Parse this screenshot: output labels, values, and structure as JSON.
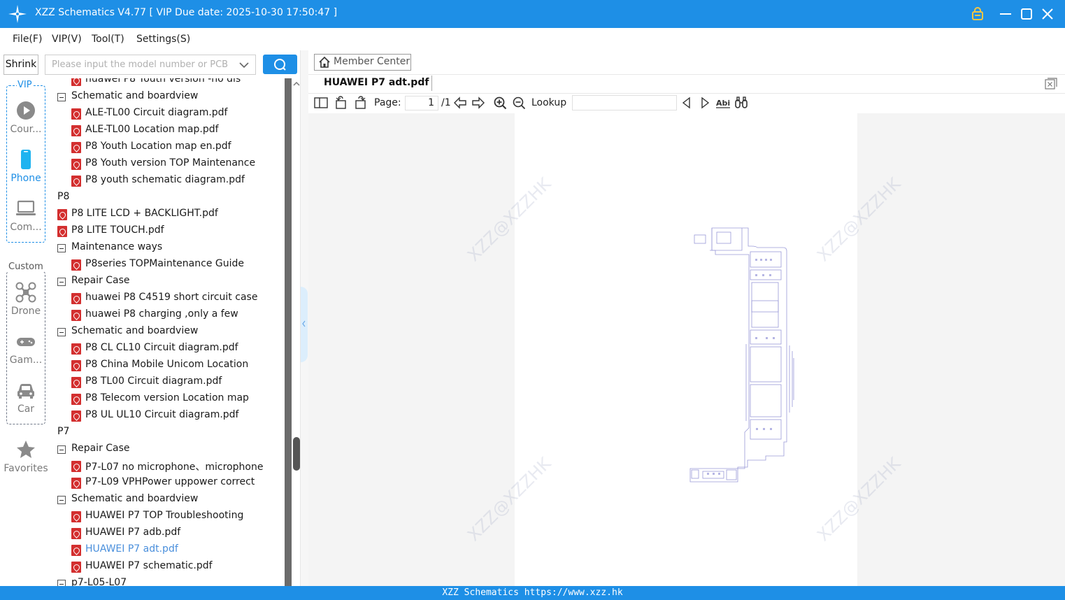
{
  "window": {
    "title": "XZZ Schematics V4.77 [ VIP Due date: 2025-10-30 17:50:47 ]"
  },
  "menu": [
    "File(F)",
    "VIP(V)",
    "Tool(T)",
    "Settings(S)"
  ],
  "search": {
    "shrink_label": "Shrink",
    "placeholder": "Please input the model number or PCB"
  },
  "sidebar": {
    "vip_label": "VIP",
    "custom_label": "Custom",
    "items": [
      {
        "label": "Cour...",
        "icon": "play-circle-icon"
      },
      {
        "label": "Phone",
        "icon": "phone-icon"
      },
      {
        "label": "Com...",
        "icon": "laptop-icon"
      },
      {
        "label": "Drone",
        "icon": "drone-icon"
      },
      {
        "label": "Gam...",
        "icon": "gamepad-icon"
      },
      {
        "label": "Car",
        "icon": "car-icon"
      },
      {
        "label": "Favorites",
        "icon": "star-icon"
      }
    ]
  },
  "tree": [
    {
      "label": "huawei P8 Youth version -no dis",
      "type": "file"
    },
    {
      "label": "Schematic and boardview",
      "type": "folder"
    },
    {
      "label": "ALE-TL00 Circuit diagram.pdf",
      "type": "file"
    },
    {
      "label": "ALE-TL00 Location map.pdf",
      "type": "file"
    },
    {
      "label": "P8 Youth Location map en.pdf",
      "type": "file"
    },
    {
      "label": "P8 Youth version TOP Maintenance",
      "type": "file"
    },
    {
      "label": "P8 youth schematic diagram.pdf",
      "type": "file"
    },
    {
      "label": "P8",
      "type": "folder"
    },
    {
      "label": "P8 LITE LCD + BACKLIGHT.pdf",
      "type": "file"
    },
    {
      "label": "P8 LITE TOUCH.pdf",
      "type": "file"
    },
    {
      "label": "Maintenance ways",
      "type": "folder"
    },
    {
      "label": "P8series TOPMaintenance Guide",
      "type": "file"
    },
    {
      "label": "Repair Case",
      "type": "folder"
    },
    {
      "label": "huawei P8 C4519 short circuit case",
      "type": "file"
    },
    {
      "label": "huawei P8 charging ,only a few",
      "type": "file"
    },
    {
      "label": "Schematic and boardview",
      "type": "folder"
    },
    {
      "label": "P8 CL CL10 Circuit diagram.pdf",
      "type": "file"
    },
    {
      "label": "P8 China Mobile Unicom Location",
      "type": "file"
    },
    {
      "label": "P8 TL00 Circuit diagram.pdf",
      "type": "file"
    },
    {
      "label": "P8 Telecom version Location map",
      "type": "file"
    },
    {
      "label": "P8 UL UL10 Circuit diagram.pdf",
      "type": "file"
    },
    {
      "label": "P7",
      "type": "folder"
    },
    {
      "label": "Repair Case",
      "type": "folder"
    },
    {
      "label": "P7-L07 no microphone、microphone",
      "type": "file"
    },
    {
      "label": "P7-L09 VPHPower uppower correct",
      "type": "file"
    },
    {
      "label": "Schematic and boardview",
      "type": "folder"
    },
    {
      "label": "HUAWEI P7 TOP Troubleshooting",
      "type": "file"
    },
    {
      "label": "HUAWEI P7 adb.pdf",
      "type": "file"
    },
    {
      "label": "HUAWEI P7 adt.pdf",
      "type": "file",
      "selected": true
    },
    {
      "label": "HUAWEI P7 schematic.pdf",
      "type": "file"
    },
    {
      "label": "p7-L05-L07",
      "type": "folder"
    }
  ],
  "right": {
    "member_center": "Member Center",
    "tab": "HUAWEI P7 adt.pdf",
    "toolbar": {
      "page_label": "Page:",
      "page_value": "1",
      "page_total": "/1",
      "lookup_label": "Lookup",
      "abi_label": "Abi"
    },
    "watermark": "XZZ@XZZHK"
  },
  "status": "XZZ Schematics https://www.xzz.hk",
  "colors": {
    "accent": "#1e8fe6",
    "pdf_red": "#d32f2f",
    "selected_text": "#4a8fdc",
    "board_line": "#9a9ad8"
  }
}
